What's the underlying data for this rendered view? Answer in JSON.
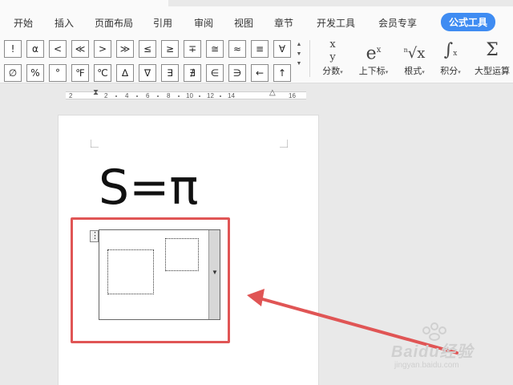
{
  "menu": [
    {
      "label": "开始"
    },
    {
      "label": "插入"
    },
    {
      "label": "页面布局"
    },
    {
      "label": "引用"
    },
    {
      "label": "审阅"
    },
    {
      "label": "视图"
    },
    {
      "label": "章节"
    },
    {
      "label": "开发工具"
    },
    {
      "label": "会员专享"
    },
    {
      "label": "公式工具"
    }
  ],
  "symbols_row1": [
    "!",
    "α",
    "<",
    "≪",
    ">",
    "≫",
    "≤",
    "≥",
    "∓",
    "≅",
    "≈",
    "≡",
    "∀"
  ],
  "symbols_row2": [
    "∅",
    "%",
    "°",
    "℉",
    "℃",
    "∆",
    "∇",
    "∃",
    "∄",
    "∈",
    "∋",
    "←",
    "↑"
  ],
  "tools": [
    {
      "icon": "x/y",
      "label": "分数"
    },
    {
      "icon": "eˣ",
      "label": "上下标"
    },
    {
      "icon": "ⁿ√x",
      "label": "根式"
    },
    {
      "icon": "∫",
      "label": "积分"
    },
    {
      "icon": "Σ",
      "label": "大型运算"
    }
  ],
  "ruler": {
    "ticks": [
      "2",
      "2",
      "4",
      "6",
      "8",
      "10",
      "12",
      "14",
      "16"
    ]
  },
  "document": {
    "equation": "S=π"
  },
  "watermark": {
    "main": "Baidu经验",
    "sub": "jingyan.baidu.com"
  },
  "colors": {
    "accent": "#3f8cf2",
    "highlight": "#e05555"
  }
}
